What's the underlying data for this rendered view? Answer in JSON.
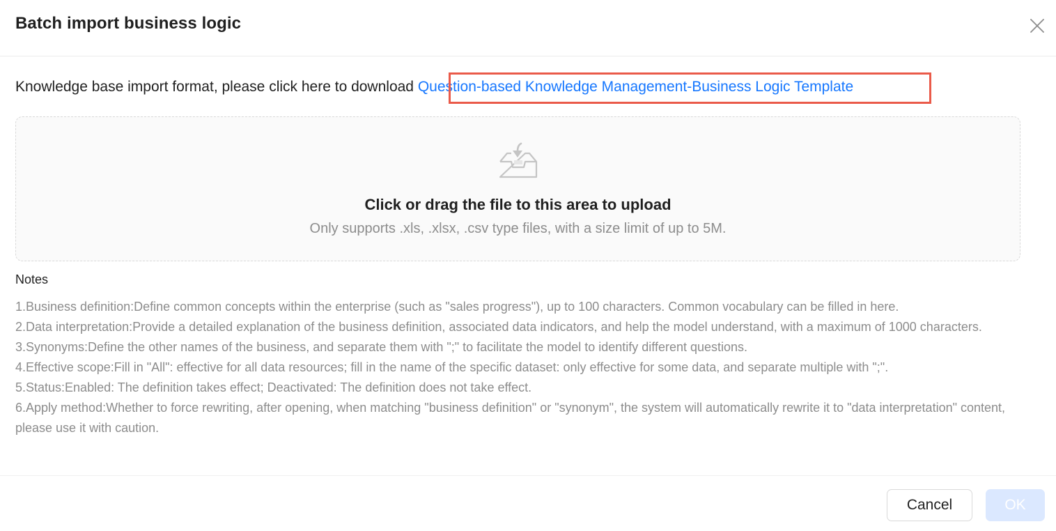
{
  "dialog": {
    "title": "Batch import business logic",
    "close_icon": "close-icon"
  },
  "download": {
    "prefix": "Knowledge base import format, please click here to download ",
    "link_label": "Question-based Knowledge Management-Business Logic Template",
    "link_color": "#1677ff",
    "highlight_color": "#ea5a49"
  },
  "upload": {
    "icon": "inbox-icon",
    "text": "Click or drag the file to this area to upload",
    "hint": "Only supports .xls, .xlsx, .csv type files, with a size limit of up to 5M."
  },
  "notes": {
    "title": "Notes",
    "items": [
      "1.Business definition:Define common concepts within the enterprise (such as \"sales progress\"), up to 100 characters. Common vocabulary can be filled in here.",
      "2.Data interpretation:Provide a detailed explanation of the business definition, associated data indicators, and help the model understand, with a maximum of 1000 characters.",
      "3.Synonyms:Define the other names of the business, and separate them with \";\" to facilitate the model to identify different questions.",
      "4.Effective scope:Fill in \"All\": effective for all data resources; fill in the name of the specific dataset: only effective for some data, and separate multiple with \";\".",
      "5.Status:Enabled: The definition takes effect; Deactivated: The definition does not take effect.",
      "6.Apply method:Whether to force rewriting, after opening, when matching \"business definition\" or \"synonym\", the system will automatically rewrite it to \"data interpretation\" content, please use it with caution."
    ]
  },
  "footer": {
    "cancel_label": "Cancel",
    "ok_label": "OK",
    "ok_disabled_color": "#dbe8ff"
  }
}
